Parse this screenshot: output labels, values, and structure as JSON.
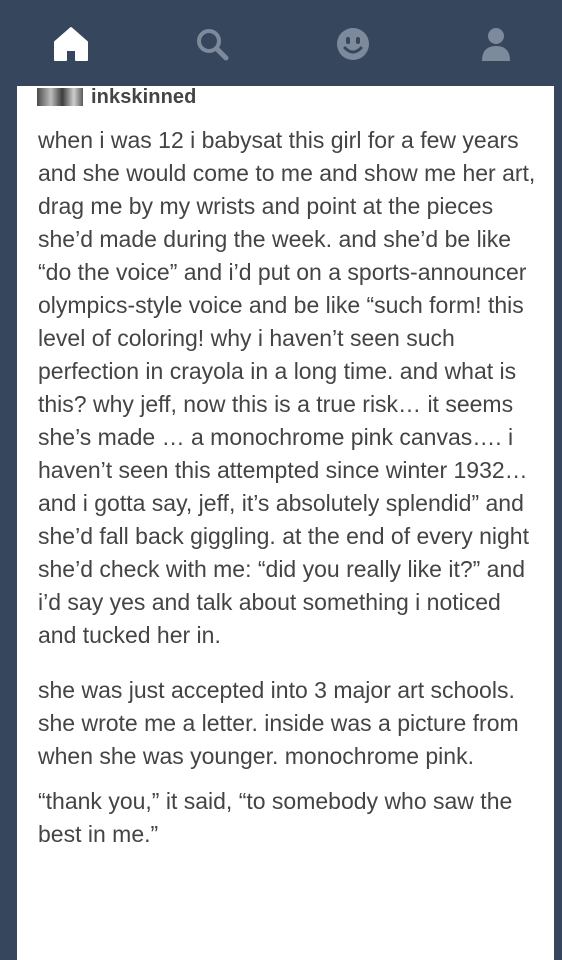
{
  "nav": {
    "items": [
      {
        "icon": "home-icon",
        "active": true
      },
      {
        "icon": "search-icon",
        "active": false
      },
      {
        "icon": "activity-smiley-icon",
        "active": false
      },
      {
        "icon": "account-icon",
        "active": false
      }
    ],
    "background": "#36465d",
    "active_color": "#ffffff",
    "inactive_color": "#7c8a9c"
  },
  "post": {
    "username": "inkskinned",
    "paragraphs": [
      "when i was 12 i babysat this girl for a few years and she would come to me and show me her art, drag me by my wrists and point at the pieces she’d made during the week. and she’d be like “do the voice” and i’d put on a sports-announcer olympics-style voice and be like “such form! this level of coloring! why i haven’t seen such perfection in crayola in a long time. and what is this? why jeff, now this is a true risk… it seems she’s made … a monochrome pink canvas…. i haven’t seen this attempted since winter 1932… and i gotta say, jeff, it’s absolutely splendid”  and she’d fall back giggling. at the end of every night she’d check with me: “did you really like it?” and i’d say yes and talk about something i noticed and tucked her in.",
      "she was just accepted into 3 major art schools. she wrote me a letter. inside was a picture from when she was younger. monochrome pink.",
      "“thank you,” it said, “to somebody who saw the best in me.”"
    ]
  }
}
